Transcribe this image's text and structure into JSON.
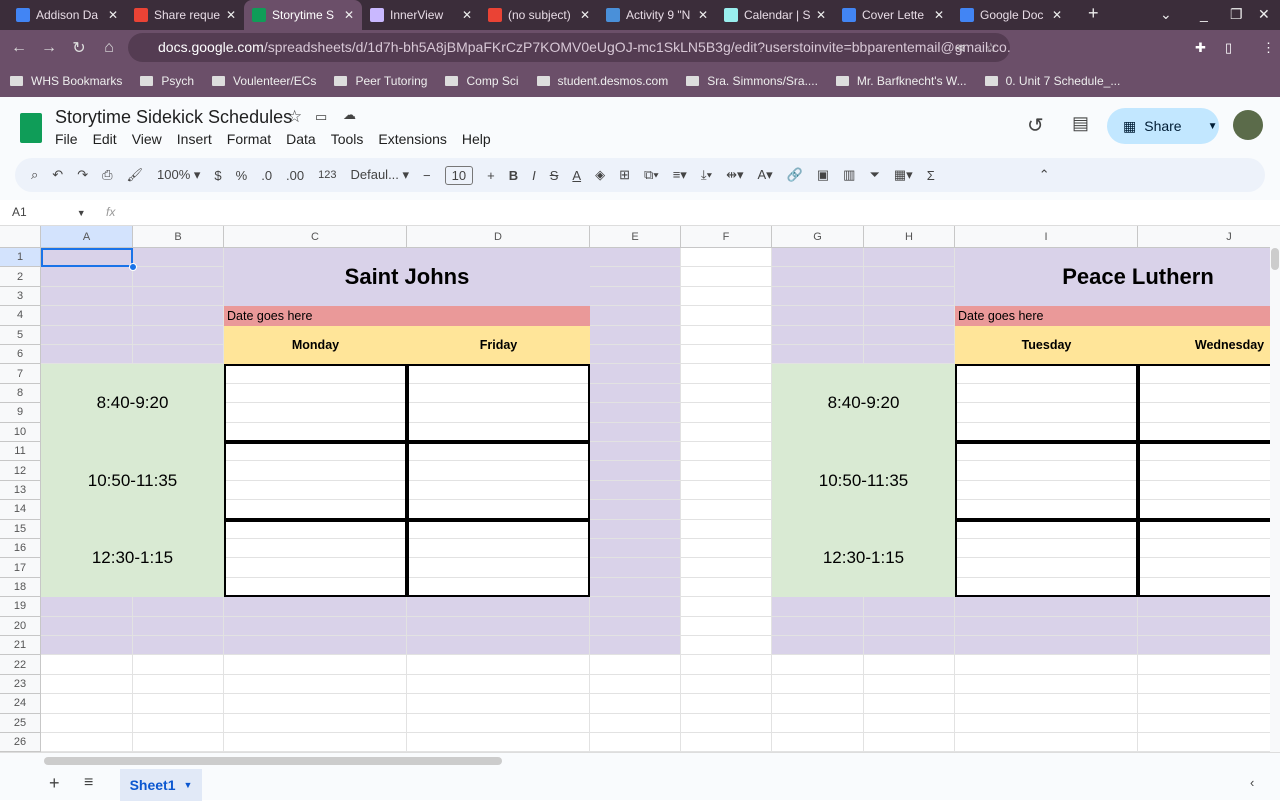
{
  "browser": {
    "tabs": [
      "Addison Da",
      "Share reque",
      "Storytime S",
      "InnerView",
      "(no subject)",
      "Activity 9 \"N",
      "Calendar | S",
      "Cover Lette",
      "Google Doc"
    ],
    "tab_icons": [
      "#4285f4",
      "#ea4335",
      "#0f9d58",
      "#c9b8ff",
      "#ea4335",
      "#4a90d9",
      "#9ee",
      "#4285f4",
      "#4285f4"
    ],
    "active_tab": 2,
    "url_host": "docs.google.com",
    "url_path": "/spreadsheets/d/1d7h-bh5A8jBMpaFKrCzP7KOMV0eUgOJ-mc1SkLN5B3g/edit?userstoinvite=bbparentemail@gmail.co...",
    "bookmarks": [
      "WHS Bookmarks",
      "Psych",
      "Voulenteer/ECs",
      "Peer Tutoring",
      "Comp Sci",
      "student.desmos.com",
      "Sra. Simmons/Sra....",
      "Mr. Barfknecht's W...",
      "0. Unit 7 Schedule_..."
    ]
  },
  "doc": {
    "title": "Storytime Sidekick Schedules",
    "menu": [
      "File",
      "Edit",
      "View",
      "Insert",
      "Format",
      "Data",
      "Tools",
      "Extensions",
      "Help"
    ],
    "share": "Share"
  },
  "toolbar": {
    "zoom": "100%",
    "currency": "$",
    "percent": "%",
    "dec_minus": ".0",
    "dec_plus": ".00",
    "format": "123",
    "font": "Defaul...",
    "font_size": "10"
  },
  "formula": {
    "cell_ref": "A1",
    "fx": "fx"
  },
  "grid": {
    "columns": [
      "A",
      "B",
      "C",
      "D",
      "E",
      "F",
      "G",
      "H",
      "I",
      "J"
    ],
    "rows": [
      1,
      2,
      3,
      4,
      5,
      6,
      7,
      8,
      9,
      10,
      11,
      12,
      13,
      14,
      15,
      16,
      17,
      18,
      19,
      20,
      21,
      22,
      23,
      24,
      25,
      26
    ],
    "left": {
      "title": "Saint Johns",
      "date": "Date goes here",
      "days": [
        "Monday",
        "Friday"
      ],
      "times": [
        "8:40-9:20",
        "10:50-11:35",
        "12:30-1:15"
      ]
    },
    "right": {
      "title": "Peace Luthern",
      "date": "Date goes here",
      "days": [
        "Tuesday",
        "Wednesday"
      ],
      "times": [
        "8:40-9:20",
        "10:50-11:35",
        "12:30-1:15"
      ]
    },
    "colors": {
      "purple": "#d9d2e9",
      "pink": "#ea9999",
      "yellow": "#ffe599",
      "green": "#d9ead3"
    }
  },
  "sheets": {
    "active": "Sheet1"
  }
}
